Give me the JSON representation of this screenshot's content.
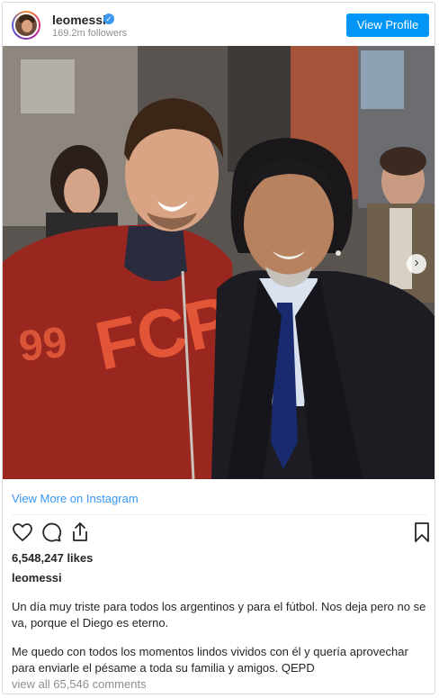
{
  "header": {
    "username": "leomessi",
    "followers": "169.2m followers",
    "view_profile_label": "View Profile"
  },
  "post": {
    "image_alt": "Photo of two men smiling together",
    "view_more_label": "View More on Instagram",
    "likes": "6,548,247 likes",
    "caption_user": "leomessi",
    "caption_paragraphs": [
      "Un día muy triste para todos los argentinos y para el fútbol. Nos deja pero no se va, porque el Diego es eterno.",
      "Me quedo con todos los momentos lindos vividos con él y quería aprovechar para enviarle el pésame a toda su familia y amigos. QEPD"
    ],
    "comments_label": "view all 65,546 comments",
    "carousel": {
      "count": 2,
      "active": 1
    }
  },
  "icons": [
    "verified-badge-icon",
    "heart-icon",
    "comment-icon",
    "share-icon",
    "bookmark-icon",
    "chevron-right-icon"
  ],
  "colors": {
    "accent": "#0095f6",
    "link": "#3897f0",
    "muted": "#8e8e8e",
    "text": "#262626"
  }
}
